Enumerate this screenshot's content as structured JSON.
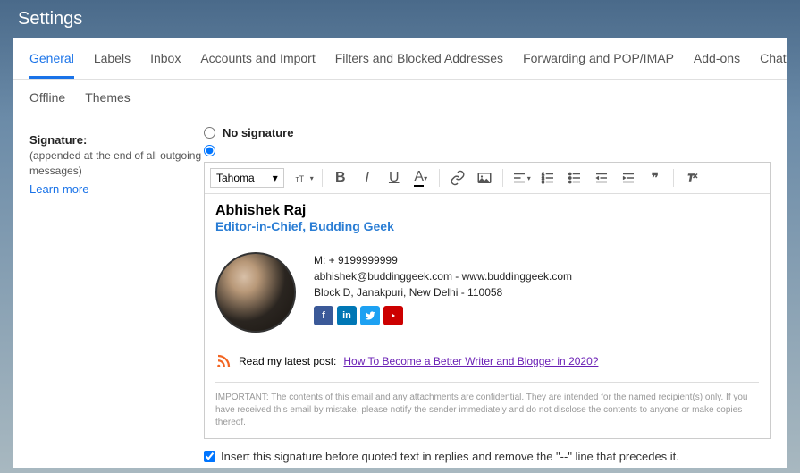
{
  "header": {
    "title": "Settings"
  },
  "tabs": [
    "General",
    "Labels",
    "Inbox",
    "Accounts and Import",
    "Filters and Blocked Addresses",
    "Forwarding and POP/IMAP",
    "Add-ons",
    "Chat"
  ],
  "subtabs": [
    "Offline",
    "Themes"
  ],
  "signature_section": {
    "label": "Signature:",
    "description": "(appended at the end of all outgoing messages)",
    "learn_more": "Learn more",
    "no_signature_label": "No signature"
  },
  "toolbar": {
    "font": "Tahoma"
  },
  "signature": {
    "name": "Abhishek Raj",
    "title": "Editor-in-Chief, Budding Geek",
    "mobile": "M: + 9199999999",
    "email_web": "abhishek@buddinggeek.com - www.buddinggeek.com",
    "address": "Block D, Janakpuri, New Delhi - 110058",
    "rss_prefix": "Read my latest post:",
    "rss_link": "How To Become a Better Writer and Blogger in 2020?",
    "disclaimer": "IMPORTANT: The contents of this email and any attachments are confidential. They are intended for the named recipient(s) only. If you have received this email by mistake, please notify the sender immediately and do not disclose the contents to anyone or make copies thereof."
  },
  "insert_checkbox": "Insert this signature before quoted text in replies and remove the \"--\" line that precedes it."
}
